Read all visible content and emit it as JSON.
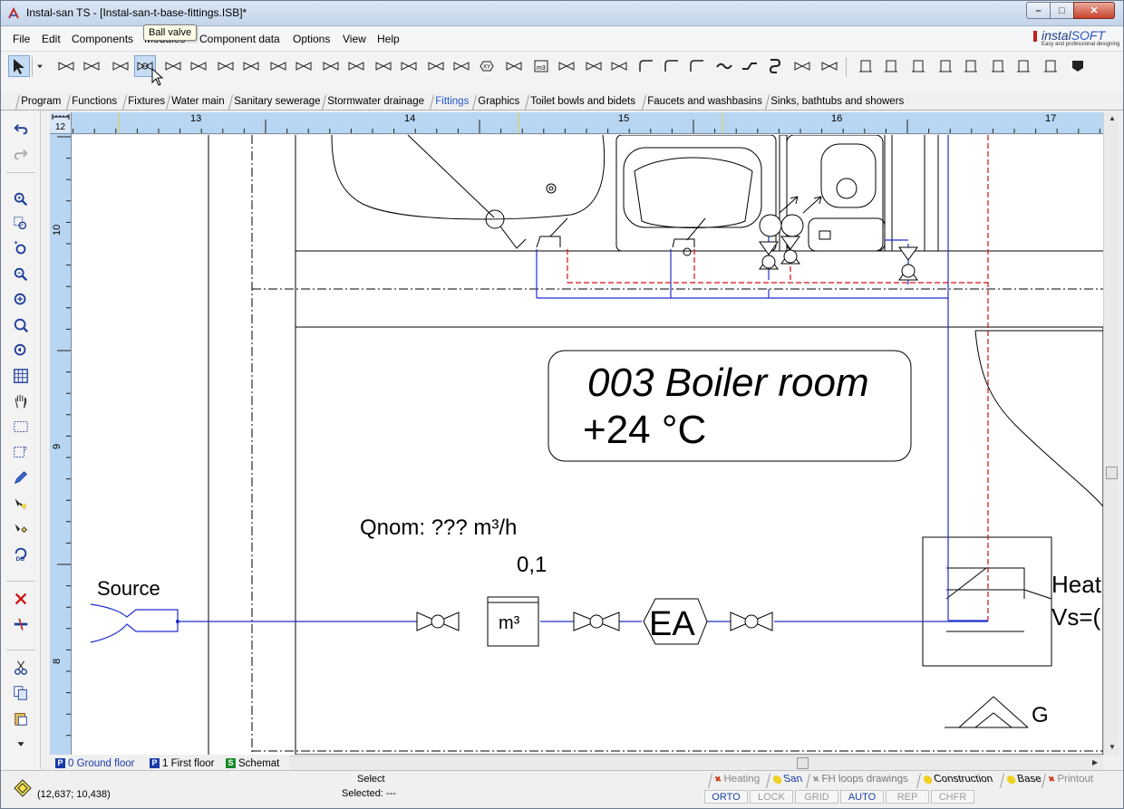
{
  "window": {
    "title": "Instal-san TS - [Instal-san-t-base-fittings.ISB]*",
    "minimize_glyph": "–",
    "maximize_glyph": "□",
    "close_glyph": "✕"
  },
  "brand": {
    "logo_text": "instal",
    "logo_text2": "SOFT",
    "tagline": "Easy and professional designing"
  },
  "menu": [
    "File",
    "Edit",
    "Components",
    "Modules",
    "Component data",
    "Options",
    "View",
    "Help"
  ],
  "tooltip": "Ball valve",
  "toolbar_icons": [
    "select-arrow-icon",
    "dropdown-arrow-icon",
    "straight-valve-icon",
    "angle-valve-icon",
    "three-way-valve-icon",
    "ball-valve-icon",
    "check-valve-icon",
    "ks-valve-icon",
    "vent-up-icon",
    "vent-hook-icon",
    "pressure-switch-icon",
    "filter-icon",
    "strainer-icon",
    "pressure-gauge-icon",
    "thermometer-icon",
    "pump-icon",
    "solenoid-valve-icon",
    "motor-valve-icon",
    "xy-fitting-icon",
    "double-valve-icon",
    "water-meter-icon",
    "cone-reducer-icon",
    "reducer-icon",
    "union-icon",
    "elbow-90-icon",
    "elbow-45-icon",
    "elbow-30-icon",
    "wave-icon",
    "offset-icon",
    "siphon-icon",
    "tap-icon",
    "flange-icon",
    "bracket-icon",
    "sleeve-icon",
    "pipe-clip-icon",
    "wall-bracket-icon",
    "floor-bracket-icon",
    "support-icon",
    "end-cap-icon",
    "coupling-icon",
    "trap-icon"
  ],
  "tabs": [
    {
      "label": "Program",
      "active": false
    },
    {
      "label": "Functions",
      "active": false
    },
    {
      "label": "Fixtures",
      "active": false
    },
    {
      "label": "Water main",
      "active": false
    },
    {
      "label": "Sanitary sewerage",
      "active": false
    },
    {
      "label": "Stormwater drainage",
      "active": false
    },
    {
      "label": "Fittings",
      "active": true
    },
    {
      "label": "Graphics",
      "active": false
    },
    {
      "label": "Toilet bowls and bidets",
      "active": false
    },
    {
      "label": "Faucets and washbasins",
      "active": false
    },
    {
      "label": "Sinks, bathtubs and showers",
      "active": false
    }
  ],
  "ruler": {
    "corner": "12",
    "h_labels": [
      "13",
      "14",
      "15",
      "16",
      "17"
    ],
    "v_labels": [
      "10",
      "9",
      "8"
    ]
  },
  "drawing": {
    "room_name": "003 Boiler room",
    "room_temp": "+24 °C",
    "qnom": "Qnom: ??? m³/h",
    "qnom_value": "0,1",
    "source_label": "Source",
    "meter_label": "m³",
    "ea_label": "EA",
    "heater_label_1": "Heat",
    "heater_label_2": "Vs=(",
    "g_label": "G",
    "supply_color": "#1f2fd0",
    "return_color": "#d01010"
  },
  "floors": [
    {
      "badge": "P",
      "label": "0 Ground floor",
      "active": true
    },
    {
      "badge": "P",
      "label": "1 First floor",
      "active": false
    },
    {
      "badge": "S",
      "label": "Schemat",
      "active": false
    }
  ],
  "status": {
    "coords": "(12,637; 10,438)",
    "select": "Select",
    "selected": "Selected: ---"
  },
  "mode_tabs": [
    {
      "label": "Heating",
      "state": "off"
    },
    {
      "label": "San",
      "state": "active"
    },
    {
      "label": "FH loops drawings",
      "state": "dim"
    },
    {
      "label": "Construction",
      "state": "on"
    },
    {
      "label": "Base",
      "state": "on"
    },
    {
      "label": "Printout",
      "state": "off"
    }
  ],
  "flags": [
    {
      "label": "ORTO",
      "on": true
    },
    {
      "label": "LOCK",
      "on": false
    },
    {
      "label": "GRID",
      "on": false
    },
    {
      "label": "AUTO",
      "on": true
    },
    {
      "label": "REP",
      "on": false
    },
    {
      "label": "CHFR",
      "on": false
    }
  ]
}
